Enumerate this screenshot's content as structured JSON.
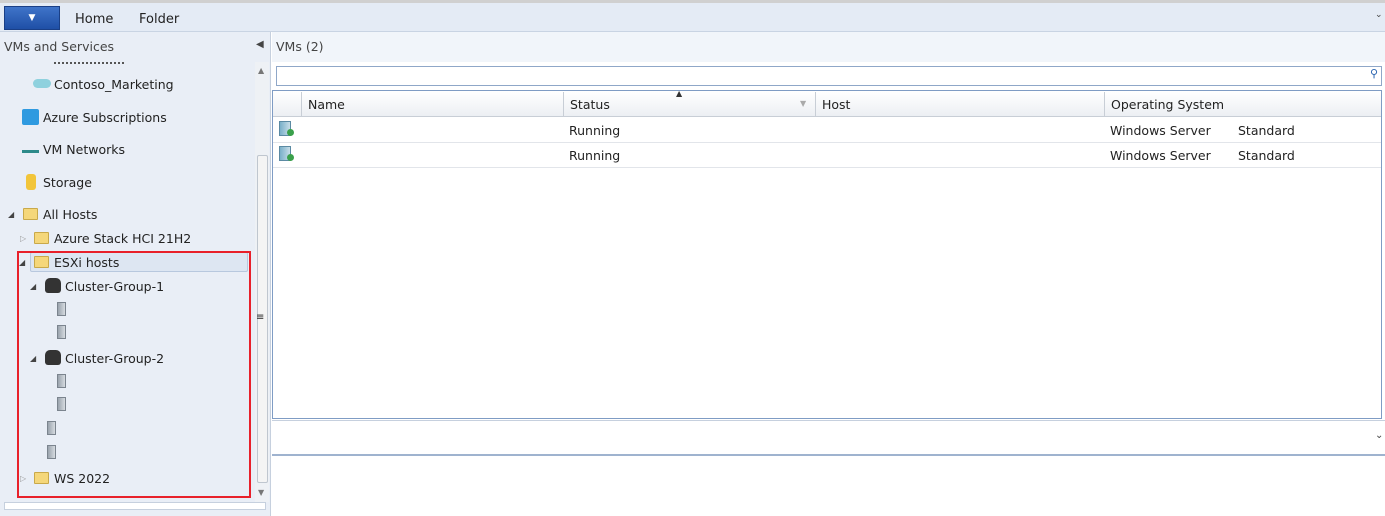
{
  "ribbon": {
    "menu_icon": "dropdown-arrow",
    "tabs": [
      "Home",
      "Folder"
    ]
  },
  "left_panel": {
    "title": "VMs and Services",
    "tree": {
      "contoso_marketing": "Contoso_Marketing",
      "azure_subscriptions": "Azure Subscriptions",
      "vm_networks": "VM Networks",
      "storage": "Storage",
      "all_hosts": "All Hosts",
      "azure_stack": "Azure Stack HCI 21H2",
      "esxi_hosts": "ESXi hosts",
      "cluster1": "Cluster-Group-1",
      "cluster2": "Cluster-Group-2",
      "ws2022": "WS 2022"
    }
  },
  "main": {
    "title": "VMs (2)",
    "search": {
      "value": "",
      "placeholder": ""
    },
    "columns": [
      "Name",
      "Status",
      "Host",
      "Operating System"
    ],
    "sort_column": "Status",
    "rows": [
      {
        "name": "",
        "status": "Running",
        "host": "",
        "os": "Windows Server",
        "edition": "Standard"
      },
      {
        "name": "",
        "status": "Running",
        "host": "",
        "os": "Windows Server",
        "edition": "Standard"
      }
    ]
  },
  "colors": {
    "highlight_box": "#e8202a",
    "selection": "#dde6f2",
    "menu_button": "#2a5cb5"
  }
}
